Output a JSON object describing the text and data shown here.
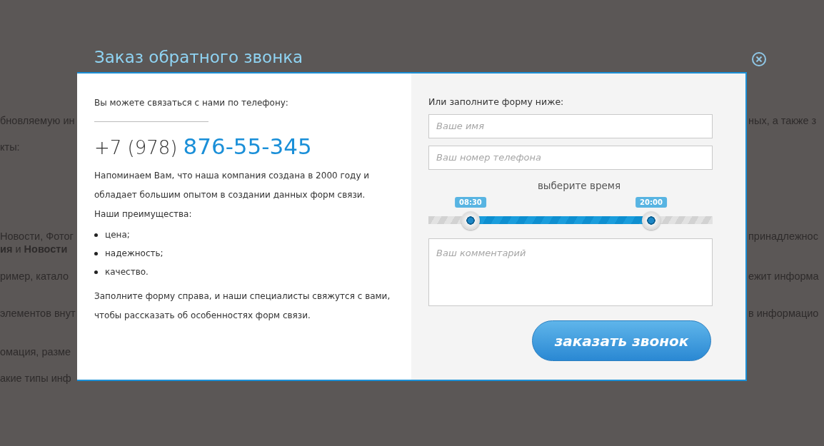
{
  "background_page": {
    "left_lines": [
      "бновляемую ин",
      "кты:",
      "Новости, Фотог",
      "**ия** и **Новости**",
      "ример, катало",
      "элементов внут",
      "омация, разме",
      "акие типы инф"
    ],
    "right_lines": [
      "ных, а также з",
      "принадлежнос",
      "ежит информа",
      "в информацио"
    ]
  },
  "modal": {
    "title": "Заказ обратного звонка",
    "contact": {
      "intro": "Вы можете связаться с нами по телефону:",
      "phone_prefix": "+7 (978)",
      "phone_number": "876-55-345",
      "about": "Напоминаем Вам, что наша компания создана в 2000 году и обладает большим опытом в создании данных форм связи.",
      "advantages_title": "Наши преимущества:",
      "advantages": [
        "цена;",
        "надежность;",
        "качество."
      ],
      "closing": "Заполните форму справа, и наши специалисты свяжутся с вами, чтобы рассказать об особенностях форм связи."
    },
    "form": {
      "heading": "Или заполните форму ниже:",
      "name_field": {
        "placeholder": "Ваше имя"
      },
      "phone_field": {
        "placeholder": "Ваш номер телефона"
      },
      "time_label": "выберите время",
      "time_handles": [
        {
          "label": "08:30",
          "level": 0.148
        },
        {
          "label": "20:00",
          "level": 0.784
        }
      ],
      "comment_field": {
        "placeholder": "Ваш комментарий"
      },
      "submit": "заказать звонок"
    }
  }
}
